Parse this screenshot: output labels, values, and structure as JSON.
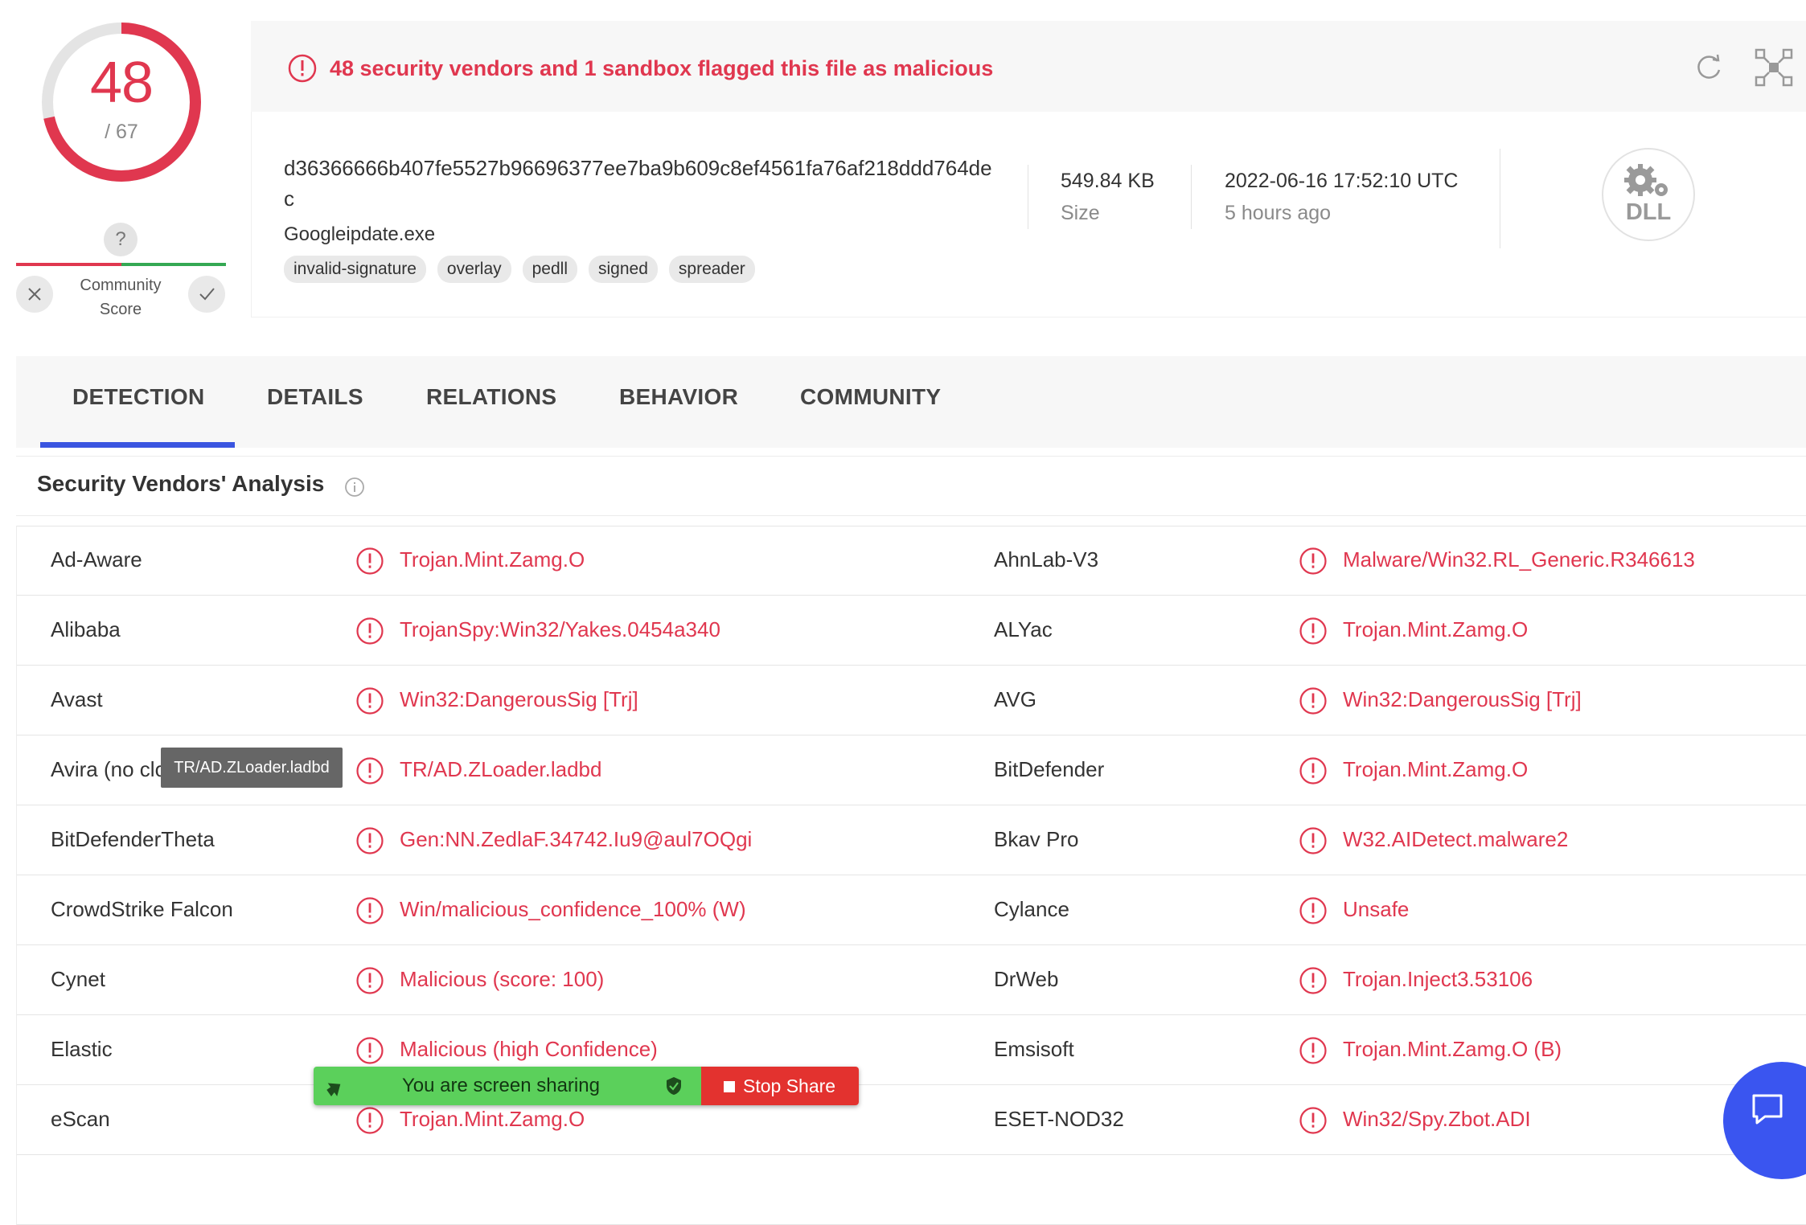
{
  "score": {
    "detections": "48",
    "total": "/ 67",
    "detection_ratio": 0.716
  },
  "community": {
    "unknown_symbol": "?",
    "label_line1": "Community",
    "label_line2": "Score"
  },
  "alert": {
    "text": "48 security vendors and 1 sandbox flagged this file as malicious"
  },
  "file": {
    "hash": "d36366666b407fe5527b96696377ee7ba9b609c8ef4561fa76af218ddd764dec",
    "name": "Googleipdate.exe",
    "tags": [
      "invalid-signature",
      "overlay",
      "pedll",
      "signed",
      "spreader"
    ],
    "size_value": "549.84 KB",
    "size_label": "Size",
    "date_value": "2022-06-16 17:52:10 UTC",
    "date_relative": "5 hours ago",
    "type": "DLL"
  },
  "tabs": [
    "DETECTION",
    "DETAILS",
    "RELATIONS",
    "BEHAVIOR",
    "COMMUNITY"
  ],
  "active_tab": "DETECTION",
  "section": {
    "title": "Security Vendors' Analysis"
  },
  "vendors": [
    {
      "left_vendor": "Ad-Aware",
      "left_result": "Trojan.Mint.Zamg.O",
      "right_vendor": "AhnLab-V3",
      "right_result": "Malware/Win32.RL_Generic.R346613"
    },
    {
      "left_vendor": "Alibaba",
      "left_result": "TrojanSpy:Win32/Yakes.0454a340",
      "right_vendor": "ALYac",
      "right_result": "Trojan.Mint.Zamg.O"
    },
    {
      "left_vendor": "Avast",
      "left_result": "Win32:DangerousSig [Trj]",
      "right_vendor": "AVG",
      "right_result": "Win32:DangerousSig [Trj]"
    },
    {
      "left_vendor": "Avira (no cloud)",
      "left_result": "TR/AD.ZLoader.ladbd",
      "right_vendor": "BitDefender",
      "right_result": "Trojan.Mint.Zamg.O"
    },
    {
      "left_vendor": "BitDefenderTheta",
      "left_result": "Gen:NN.ZedlaF.34742.Iu9@aul7OQgi",
      "right_vendor": "Bkav Pro",
      "right_result": "W32.AIDetect.malware2"
    },
    {
      "left_vendor": "CrowdStrike Falcon",
      "left_result": "Win/malicious_confidence_100% (W)",
      "right_vendor": "Cylance",
      "right_result": "Unsafe"
    },
    {
      "left_vendor": "Cynet",
      "left_result": "Malicious (score: 100)",
      "right_vendor": "DrWeb",
      "right_result": "Trojan.Inject3.53106"
    },
    {
      "left_vendor": "Elastic",
      "left_result": "Malicious (high Confidence)",
      "right_vendor": "Emsisoft",
      "right_result": "Trojan.Mint.Zamg.O (B)"
    },
    {
      "left_vendor": "eScan",
      "left_result": "Trojan.Mint.Zamg.O",
      "right_vendor": "ESET-NOD32",
      "right_result": "Win32/Spy.Zbot.ADI"
    },
    {
      "left_vendor": "",
      "left_result": "",
      "right_vendor": "",
      "right_result": ""
    }
  ],
  "tooltip": {
    "text": "TR/AD.ZLoader.ladbd"
  },
  "screen_share": {
    "message": "You are screen sharing",
    "stop_label": "Stop Share"
  },
  "colors": {
    "malicious": "#e0374f",
    "tab_indicator": "#3a55e0",
    "share_green": "#5bd05b",
    "stop_red": "#e3322f",
    "chat_blue": "#3a55f0"
  }
}
